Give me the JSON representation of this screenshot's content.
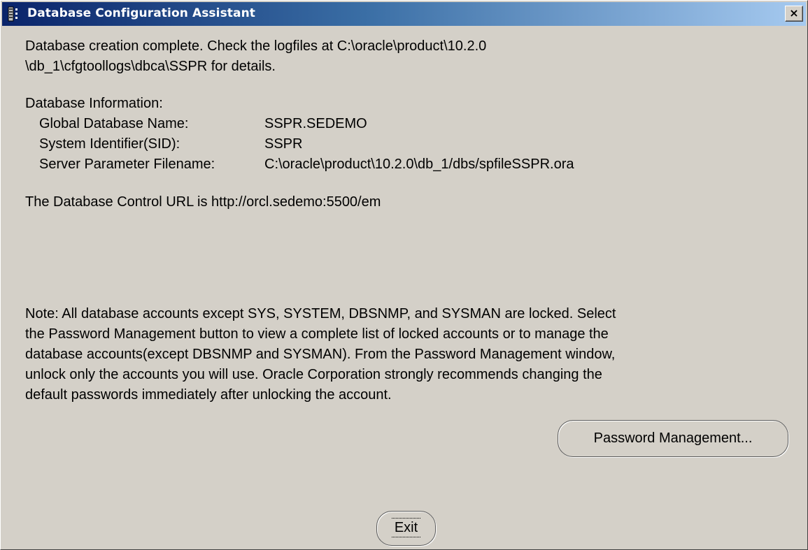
{
  "window": {
    "title": "Database Configuration Assistant",
    "icon": "database-icon",
    "close_label": "×",
    "titlebar_color_start": "#0a246a",
    "titlebar_color_end": "#a6caf0"
  },
  "message": {
    "line1": "Database creation complete. Check the logfiles at C:\\oracle\\product\\10.2.0",
    "line2": "\\db_1\\cfgtoollogs\\dbca\\SSPR for details."
  },
  "database_info": {
    "heading": "Database Information:",
    "rows": [
      {
        "label": "Global Database Name:",
        "value": "SSPR.SEDEMO"
      },
      {
        "label": "System Identifier(SID):",
        "value": "SSPR"
      },
      {
        "label": "Server Parameter Filename:",
        "value": "C:\\oracle\\product\\10.2.0\\db_1/dbs/spfileSSPR.ora"
      }
    ]
  },
  "control_url_text": "The Database Control URL is http://orcl.sedemo:5500/em",
  "note": {
    "lines": [
      "Note: All database accounts except SYS, SYSTEM, DBSNMP, and SYSMAN are locked. Select",
      "the Password Management button to view a complete list of locked accounts or to manage the",
      "database accounts(except DBSNMP and SYSMAN). From the Password Management window,",
      "unlock only the accounts you will use. Oracle Corporation strongly recommends changing the",
      "default passwords immediately after unlocking the account."
    ]
  },
  "buttons": {
    "password_management": "Password Management...",
    "exit": "Exit"
  }
}
